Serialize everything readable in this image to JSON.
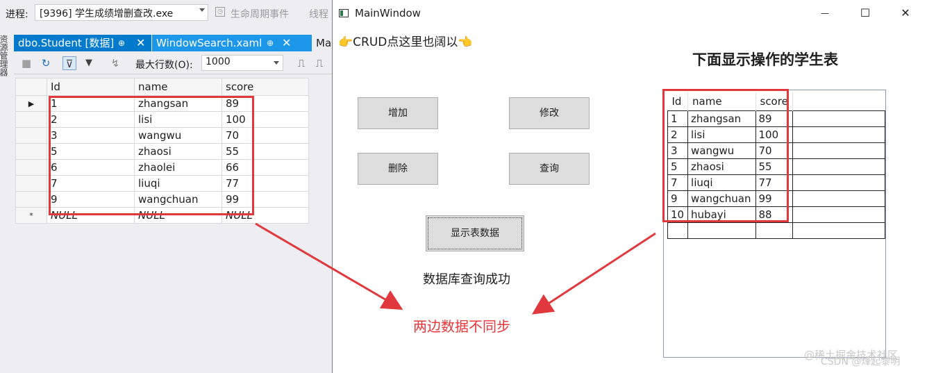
{
  "vs": {
    "process_label": "进程:",
    "process_value": "[9396] 学生成绩增删查改.exe",
    "lifecycle_label": "生命周期事件",
    "thread_label": "线程",
    "side_text": "资源管理器",
    "tabs": [
      {
        "label": "dbo.Student [数据]",
        "pin": "⊕",
        "close": "✕"
      },
      {
        "label": "WindowSearch.xaml",
        "pin": "⊕",
        "close": "✕"
      },
      {
        "label": "MainW"
      }
    ],
    "toolbar": {
      "stop_icon": "■",
      "refresh_icon": "↻",
      "filter_icon": "⊽",
      "funnel_icon": "▼",
      "sql_icon": "↯",
      "maxrows_label": "最大行数(O):",
      "maxrows_value": "1000"
    },
    "grid": {
      "columns": [
        "Id",
        "name",
        "score"
      ],
      "current_marker": "▶",
      "new_marker": "*",
      "rows": [
        [
          "1",
          "zhangsan",
          "89"
        ],
        [
          "2",
          "lisi",
          "100"
        ],
        [
          "3",
          "wangwu",
          "70"
        ],
        [
          "5",
          "zhaosi",
          "55"
        ],
        [
          "6",
          "zhaolei",
          "66"
        ],
        [
          "7",
          "liuqi",
          "77"
        ],
        [
          "9",
          "wangchuan",
          "99"
        ]
      ],
      "null_row": [
        "NULL",
        "NULL",
        "NULL"
      ]
    }
  },
  "wpf": {
    "title": "MainWindow",
    "minimize": "—",
    "maximize": "☐",
    "close": "✕",
    "crud_hint": "👉CRUD点这里也阔以👈",
    "table_title": "下面显示操作的学生表",
    "buttons": {
      "add": "增加",
      "edit": "修改",
      "delete": "删除",
      "query": "查询",
      "show": "显示表数据"
    },
    "status": "数据库查询成功",
    "grid": {
      "columns": [
        "Id",
        "name",
        "score"
      ],
      "rows": [
        [
          "1",
          "zhangsan",
          "89"
        ],
        [
          "2",
          "lisi",
          "100"
        ],
        [
          "3",
          "wangwu",
          "70"
        ],
        [
          "5",
          "zhaosi",
          "55"
        ],
        [
          "7",
          "liuqi",
          "77"
        ],
        [
          "9",
          "wangchuan",
          "99"
        ],
        [
          "10",
          "hubayi",
          "88"
        ],
        [
          "",
          "",
          ""
        ]
      ]
    }
  },
  "annotation": {
    "sync_text": "两边数据不同步",
    "accent_color": "#e0383c"
  },
  "watermark": {
    "line1": "@稀土掘金技术社区",
    "line2": "CSDN @烽起黎明"
  }
}
